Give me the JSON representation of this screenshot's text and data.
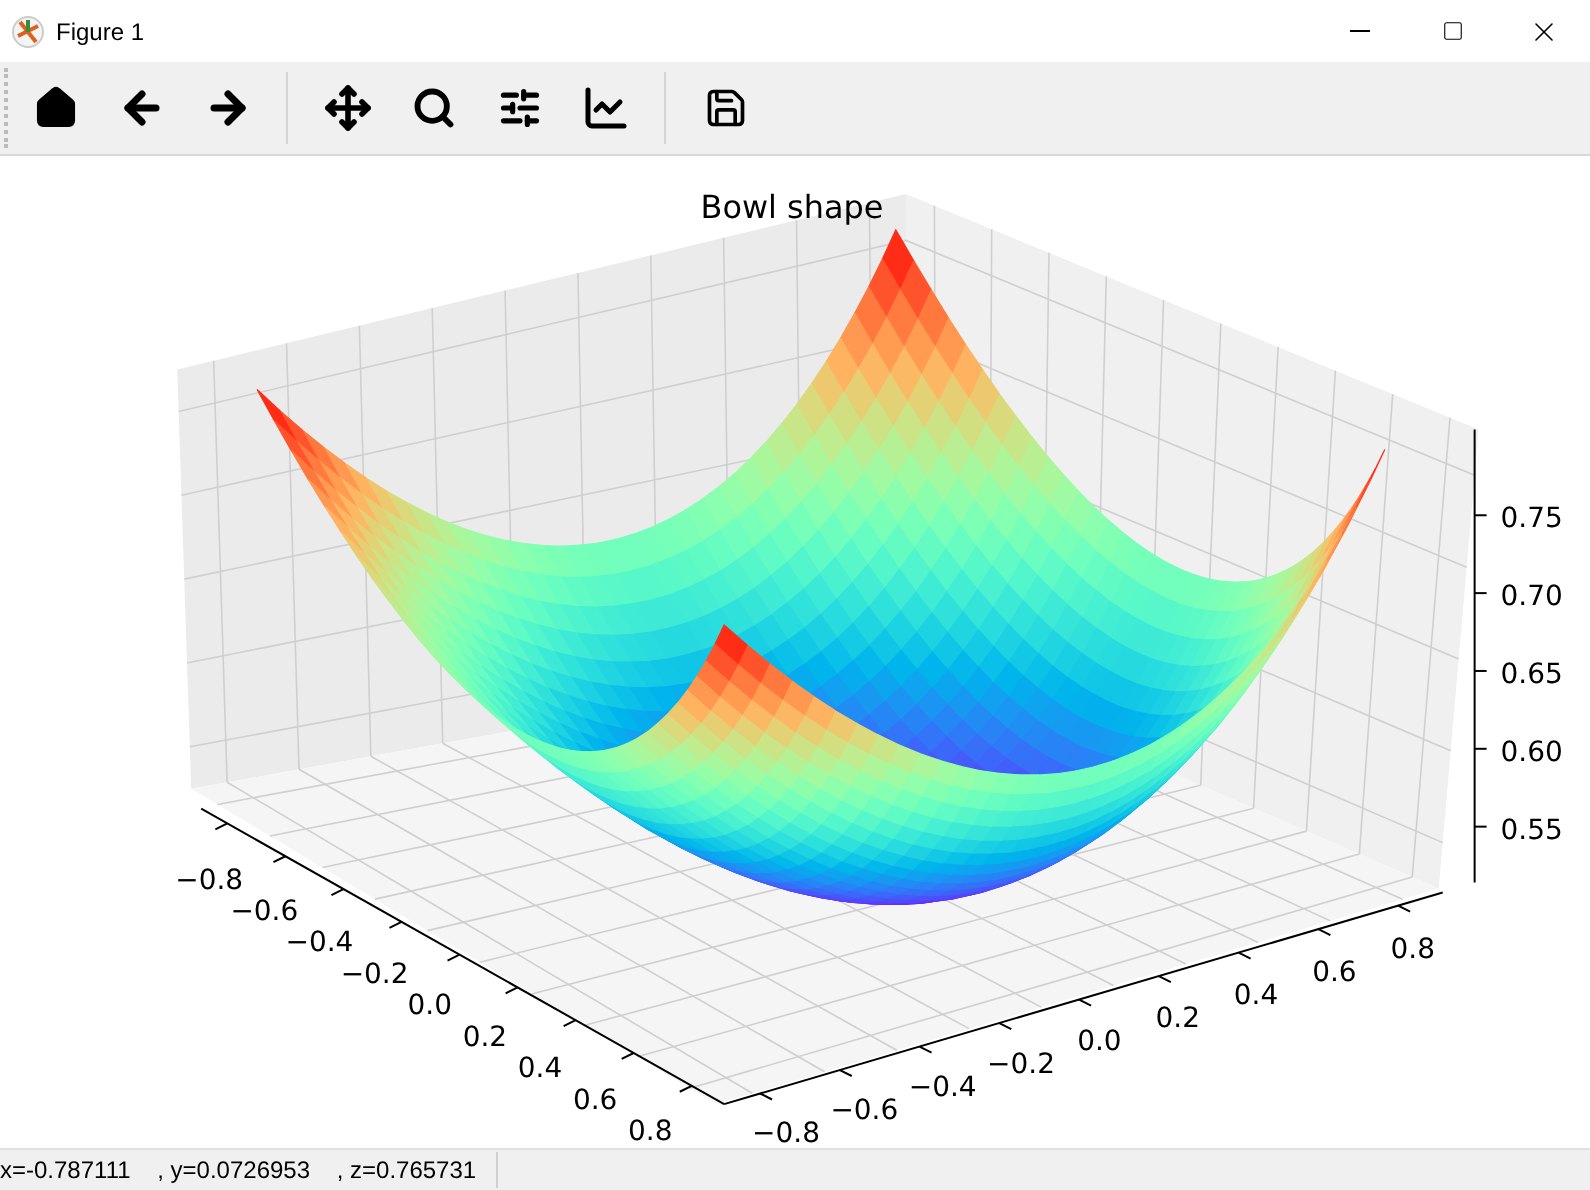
{
  "window": {
    "title": "Figure 1"
  },
  "plot": {
    "title": "Bowl shape",
    "x_ticks": [
      "−0.8",
      "−0.6",
      "−0.4",
      "−0.2",
      "0.0",
      "0.2",
      "0.4",
      "0.6",
      "0.8"
    ],
    "y_ticks": [
      "−0.8",
      "−0.6",
      "−0.4",
      "−0.2",
      "0.0",
      "0.2",
      "0.4",
      "0.6",
      "0.8"
    ],
    "z_ticks": [
      "0.75",
      "0.70",
      "0.65",
      "0.60",
      "0.55"
    ]
  },
  "status_bar": {
    "text": "x=-0.787111    , y=0.0726953    , z=0.765731"
  }
}
